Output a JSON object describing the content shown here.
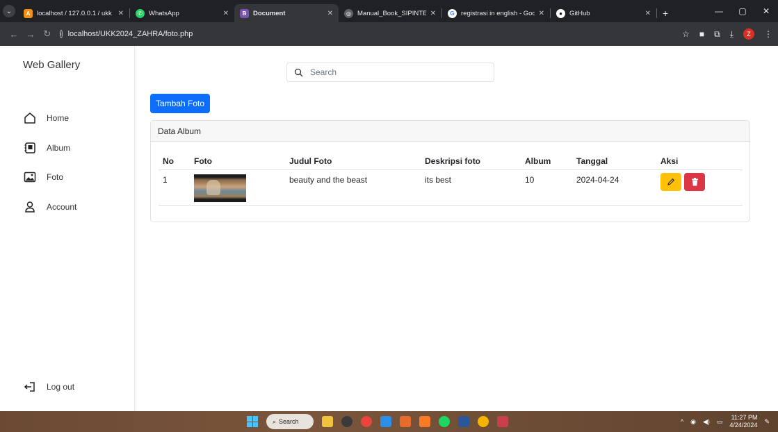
{
  "browser": {
    "tabs": [
      {
        "title": "localhost / 127.0.0.1 / ukk",
        "active": false,
        "icon": "phpmyadmin-icon"
      },
      {
        "title": "WhatsApp",
        "active": false,
        "icon": "whatsapp-icon"
      },
      {
        "title": "Document",
        "active": true,
        "icon": "bootstrap-icon"
      },
      {
        "title": "Manual_Book_SIPINTER.p",
        "active": false,
        "icon": "globe-icon"
      },
      {
        "title": "registrasi in english - Goo",
        "active": false,
        "icon": "google-icon"
      },
      {
        "title": "GitHub",
        "active": false,
        "icon": "github-icon"
      }
    ],
    "url": "localhost/UKK2024_ZAHRA/foto.php",
    "profile_initial": "Z"
  },
  "sidebar": {
    "brand": "Web Gallery",
    "items": [
      {
        "label": "Home",
        "icon": "house-icon"
      },
      {
        "label": "Album",
        "icon": "album-icon"
      },
      {
        "label": "Foto",
        "icon": "image-icon"
      },
      {
        "label": "Account",
        "icon": "person-icon"
      }
    ],
    "logout_label": "Log out"
  },
  "search": {
    "placeholder": "Search",
    "value": ""
  },
  "add_button_label": "Tambah Foto",
  "card": {
    "title": "Data Album",
    "columns": [
      "No",
      "Foto",
      "Judul Foto",
      "Deskripsi foto",
      "Album",
      "Tanggal",
      "Aksi"
    ],
    "rows": [
      {
        "no": "1",
        "judul": "beauty and the beast",
        "deskripsi": "its best",
        "album": "10",
        "tanggal": "2024-04-24"
      }
    ]
  },
  "taskbar": {
    "search_label": "Search",
    "time": "11:27 PM",
    "date": "4/24/2024"
  },
  "colors": {
    "primary": "#0d6efd",
    "warning": "#ffc107",
    "danger": "#dc3545"
  }
}
